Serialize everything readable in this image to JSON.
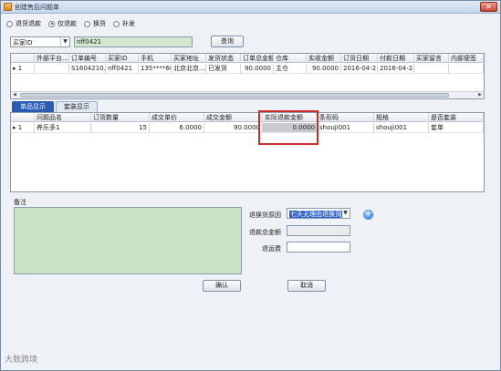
{
  "window": {
    "title": "创建售后问题单",
    "close_label": "✕"
  },
  "radios": [
    {
      "label": "退货退款",
      "checked": false
    },
    {
      "label": "仅退款",
      "checked": true
    },
    {
      "label": "换货",
      "checked": false
    },
    {
      "label": "补发",
      "checked": false
    }
  ],
  "search": {
    "field_select": "买家ID",
    "value": "nff0421",
    "query_button": "查询"
  },
  "order_table": {
    "headers": [
      "外部平台...",
      "订单编号",
      "买家ID",
      "手机",
      "买家地址",
      "发货状态",
      "订单总金额",
      "仓库",
      "实收金额",
      "订货日期",
      "付款日期",
      "买家留言",
      "内部便签"
    ],
    "rows": [
      {
        "marker": "▸ 1",
        "cells": [
          "",
          "S1604210...",
          "nff0421",
          "135****60...",
          "北京北京...",
          "已发货",
          "90.0000",
          "主仓",
          "90.0000",
          "2016-04-2...",
          "2016-04-2...",
          "",
          ""
        ]
      }
    ]
  },
  "tabs": [
    {
      "label": "单品显示",
      "active": true
    },
    {
      "label": "套装显示",
      "active": false
    }
  ],
  "item_table": {
    "headers": [
      "问题品名",
      "订货数量",
      "成交单价",
      "成交金额",
      "实际退款金额",
      "条形码",
      "规格",
      "是否套装"
    ],
    "rows": [
      {
        "marker": "▸ 1",
        "cells": [
          "养乐多1",
          "15",
          "6.0000",
          "90.0000",
          "0.0000",
          "shouji001",
          "shouji001",
          "套单"
        ]
      }
    ]
  },
  "notes_label": "备注",
  "form": {
    "reason_label": "退换货原因",
    "reason_value": "七天无理由退换货",
    "refund_total_label": "退款总金额",
    "shipping_fee_label": "退运费"
  },
  "buttons": {
    "confirm": "确认",
    "cancel": "取消"
  },
  "watermark": "大数跨境",
  "colors": {
    "accent": "#2b5cb5",
    "highlight_border": "#cf2d2d",
    "notes_bg": "#c9e4c4"
  }
}
